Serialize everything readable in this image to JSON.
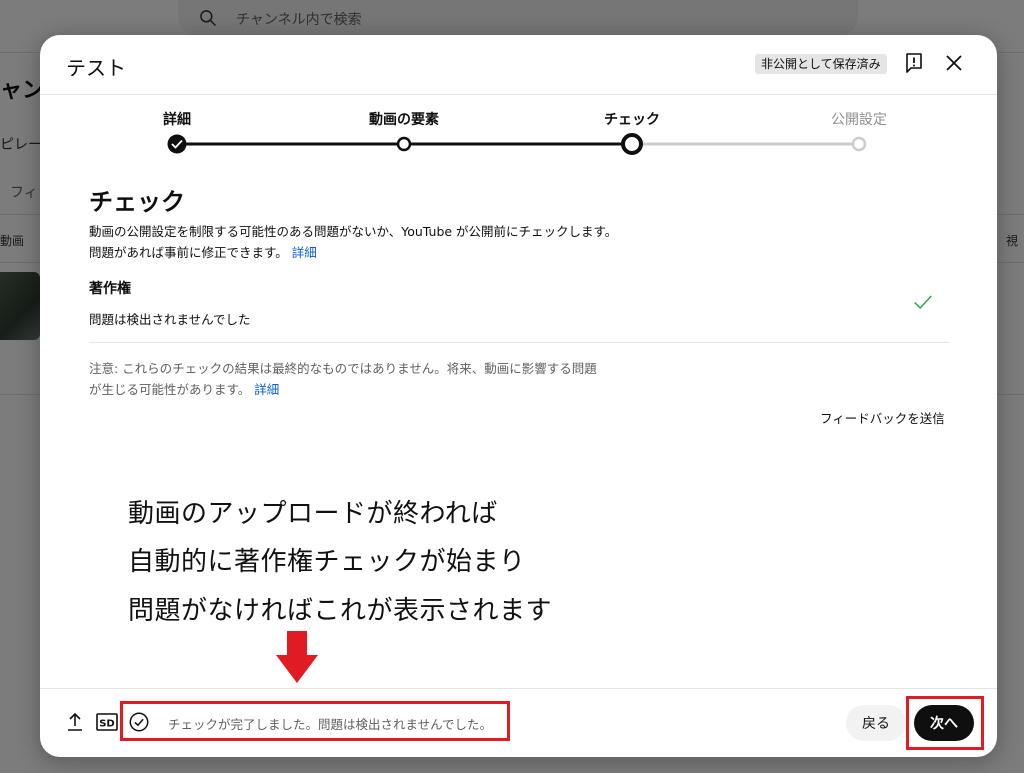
{
  "background": {
    "search_placeholder": "チャンネル内で検索",
    "side_text_1": "ャン",
    "side_text_2": "ピレー",
    "side_text_3": "フィ",
    "col_video": "動画",
    "col_right": "視"
  },
  "dialog": {
    "title": "テスト",
    "saved_badge": "非公開として保存済み"
  },
  "stepper": {
    "steps": [
      {
        "label": "詳細",
        "state": "done"
      },
      {
        "label": "動画の要素",
        "state": "done"
      },
      {
        "label": "チェック",
        "state": "active"
      },
      {
        "label": "公開設定",
        "state": "pending"
      }
    ]
  },
  "check": {
    "title": "チェック",
    "description": "動画の公開設定を制限する可能性のある問題がないか、YouTube が公開前にチェックします。問題があれば事前に修正できます。",
    "description_link": "詳細",
    "copyright_title": "著作権",
    "copyright_status": "問題は検出されませんでした",
    "note": "注意: これらのチェックの結果は最終的なものではありません。将来、動画に影響する問題が生じる可能性があります。",
    "note_link": "詳細",
    "send_feedback": "フィードバックを送信"
  },
  "annotation": {
    "line1": "動画のアップロードが終われば",
    "line2": "自動的に著作権チェックが始まり",
    "line3": "問題がなければこれが表示されます"
  },
  "footer": {
    "sd_badge": "SD",
    "status_text": "チェックが完了しました。問題は検出されませんでした。",
    "back_label": "戻る",
    "next_label": "次へ"
  },
  "colors": {
    "accent_red": "#e01b24",
    "link_blue": "#065fd4",
    "check_green": "#2ba640"
  }
}
